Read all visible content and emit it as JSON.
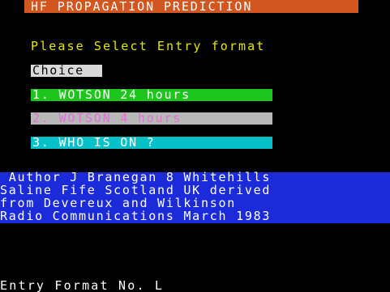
{
  "screen": {
    "title": "HF PROPAGATION PREDICTION",
    "prompt": "Please Select Entry format",
    "choice_label": "Choice",
    "options": [
      {
        "label": "1. WOTSON 24 hours",
        "background": "#1dc61d",
        "color": "#ffffff"
      },
      {
        "label": "2. WOTSON 4 hours",
        "background": "#b8b8b8",
        "color": "#e16fd6"
      },
      {
        "label": "3. WHO IS ON ?",
        "background": "#06c2c8",
        "color": "#ffffff"
      }
    ],
    "credits": [
      " Author J Branegan 8 Whitehills",
      "Saline Fife Scotland UK derived",
      "from Devereux and Wilkinson",
      "Radio Communications March 1983"
    ],
    "entry_prompt": "Entry Format No. L"
  },
  "colors": {
    "background": "#000000",
    "title_bar": "#d2561f",
    "prompt_text": "#e6e600",
    "credits_bar": "#1b2bd9"
  }
}
